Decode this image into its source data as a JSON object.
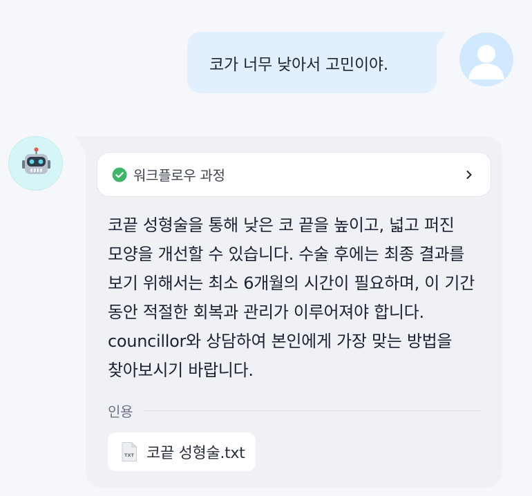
{
  "user_message": {
    "text": "코가 너무 낮아서 고민이야."
  },
  "bot_message": {
    "workflow": {
      "label": "워크플로우 과정",
      "status_icon": "check-circle-icon",
      "expand_icon": "chevron-right-icon"
    },
    "answer": "코끝 성형술을 통해 낮은 코 끝을 높이고, 넓고 퍼진 모양을 개선할 수 있습니다. 수술 후에는 최종 결과를 보기 위해서는 최소 6개월의 시간이 필요하며, 이 기간 동안 적절한 회복과 관리가 이루어져야 합니다. councillor와 상담하여 본인에게 가장 맞는 방법을 찾아보시기 바랍니다.",
    "citations": {
      "label": "인용",
      "files": [
        {
          "name": "코끝 성형술.txt",
          "icon": "txt-file-icon",
          "icon_text": "TXT"
        }
      ]
    }
  },
  "colors": {
    "page_bg": "#f6f7fa",
    "user_bubble": "#e1effe",
    "bot_bubble": "#f0f1f5",
    "check_green": "#3fb56a",
    "user_avatar_bg": "#d1e9ff",
    "bot_avatar_bg": "#d5f5f6"
  }
}
